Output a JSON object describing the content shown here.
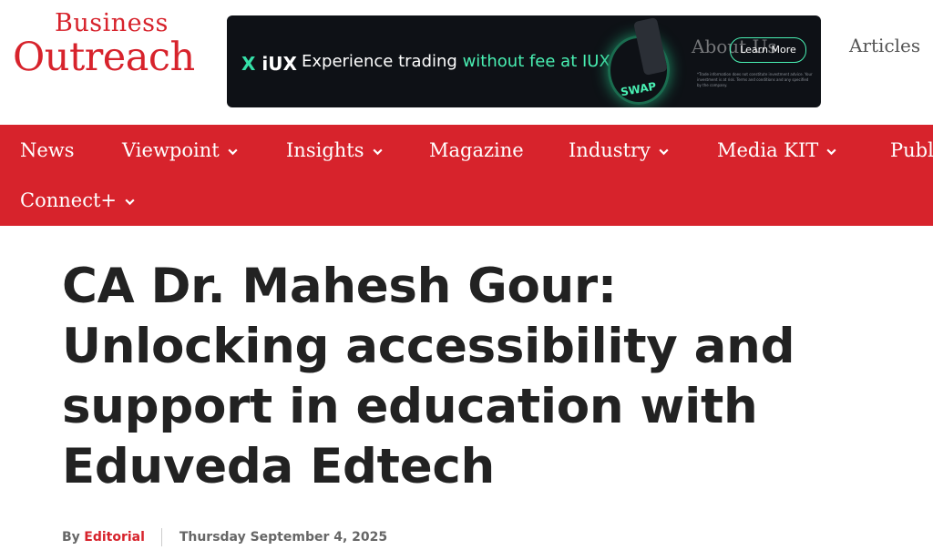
{
  "logo": {
    "line1": "Business",
    "line2": "Outreach"
  },
  "ad": {
    "brand": "iUX",
    "message_pre": "Experience trading ",
    "message_highlight": "without fee at IUX",
    "swap_text": "SWAP",
    "cta": "Learn More",
    "overlay_text": "About Us",
    "fine_print": "*Trade information does not constitute investment advice. Your investment is at risk. Terms and conditions and any specified by the company."
  },
  "header": {
    "articles_link": "Articles"
  },
  "nav": {
    "items": [
      {
        "label": "News",
        "dropdown": false
      },
      {
        "label": "Viewpoint",
        "dropdown": true
      },
      {
        "label": "Insights",
        "dropdown": true
      },
      {
        "label": "Magazine",
        "dropdown": false
      },
      {
        "label": "Industry",
        "dropdown": true
      },
      {
        "label": "Media KIT",
        "dropdown": true
      },
      {
        "label": "Publi",
        "dropdown": false
      },
      {
        "label": "Connect+",
        "dropdown": true
      }
    ]
  },
  "article": {
    "title": "CA Dr. Mahesh Gour: Unlocking accessibility and support in education with Eduveda Edtech",
    "by_label": "By",
    "author": "Editorial",
    "date": "Thursday September 4, 2025"
  },
  "colors": {
    "brand_red": "#d7232c",
    "ad_green": "#49f0b3",
    "title": "#222222"
  }
}
